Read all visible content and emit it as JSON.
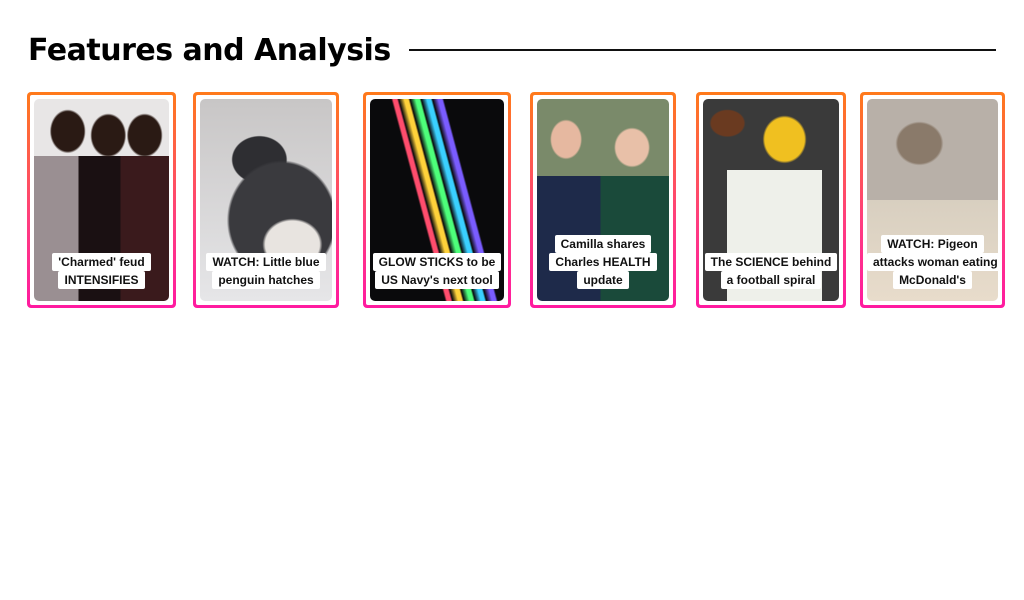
{
  "section": {
    "title": "Features and Analysis"
  },
  "cards": [
    {
      "caption": "'Charmed' feud INTENSIFIES",
      "image": "three women posing"
    },
    {
      "caption": "WATCH: Little blue penguin hatches",
      "image": "penguin chick"
    },
    {
      "caption": "GLOW STICKS to be US Navy's next tool",
      "image": "glow sticks"
    },
    {
      "caption": "Camilla shares Charles HEALTH update",
      "image": "royal couple"
    },
    {
      "caption": "The SCIENCE behind a football spiral",
      "image": "quarterback throwing"
    },
    {
      "caption": "WATCH: Pigeon attacks woman eating McDonald's",
      "image": "woman and pigeon"
    }
  ],
  "colors": {
    "border_top": "#ff7a1a",
    "border_bottom": "#ff1aa0"
  }
}
